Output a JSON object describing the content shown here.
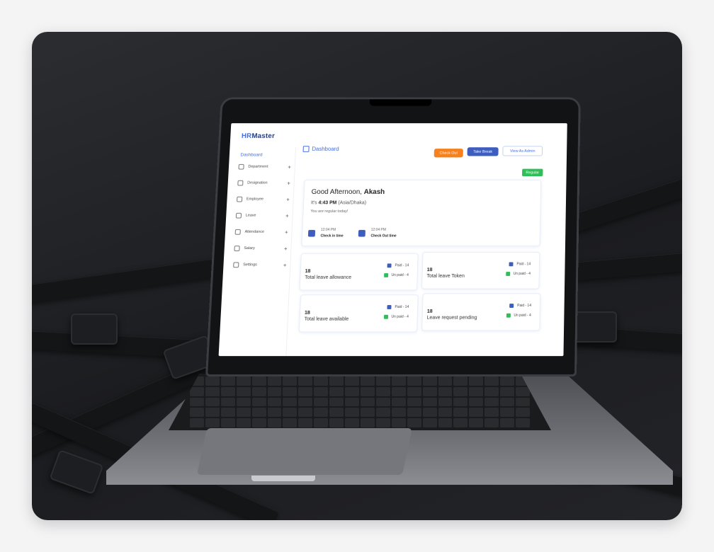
{
  "app": {
    "brand_prefix": "HR",
    "brand_suffix": "Master",
    "sidebar": {
      "active": "Dashboard",
      "items": [
        {
          "label": "Department",
          "icon": "department-icon"
        },
        {
          "label": "Designation",
          "icon": "designation-icon"
        },
        {
          "label": "Employee",
          "icon": "employee-icon"
        },
        {
          "label": "Leave",
          "icon": "leave-icon"
        },
        {
          "label": "Attendance",
          "icon": "attendance-icon"
        },
        {
          "label": "Salary",
          "icon": "salary-icon"
        },
        {
          "label": "Settings",
          "icon": "settings-icon"
        }
      ],
      "plus": "+"
    },
    "header": {
      "title": "Dashboard",
      "check_out": "Check Out",
      "take_break": "Take Break",
      "view_admin": "View As Admin"
    },
    "status_badge": "Regular",
    "greeting": {
      "prefix": "Good Afternoon,",
      "name": "Akash",
      "time_prefix": "It's",
      "time": "4:43 PM",
      "tz": "(Asia/Dhaka)",
      "note": "You are regular today!"
    },
    "checkin": {
      "time": "12:04 PM",
      "label": "Check in time"
    },
    "checkout": {
      "time": "12:04 PM",
      "label": "Check Out time"
    },
    "stats": [
      {
        "value": "18",
        "label": "Total leave allowance",
        "paid": "Paid - 14",
        "unpaid": "Un paid - 4"
      },
      {
        "value": "18",
        "label": "Total leave Token",
        "paid": "Paid - 14",
        "unpaid": "Un paid - 4"
      },
      {
        "value": "18",
        "label": "Total leave available",
        "paid": "Paid - 14",
        "unpaid": "Un paid - 4"
      },
      {
        "value": "18",
        "label": "Leave request pending",
        "paid": "Paid - 14",
        "unpaid": "Un paid - 4"
      }
    ]
  },
  "colors": {
    "accent": "#3d6be8",
    "check_out": "#f5821f",
    "take_break": "#3d5dbf",
    "regular": "#2fbf59",
    "paid": "#3d5dbf",
    "unpaid": "#2fbf59"
  }
}
